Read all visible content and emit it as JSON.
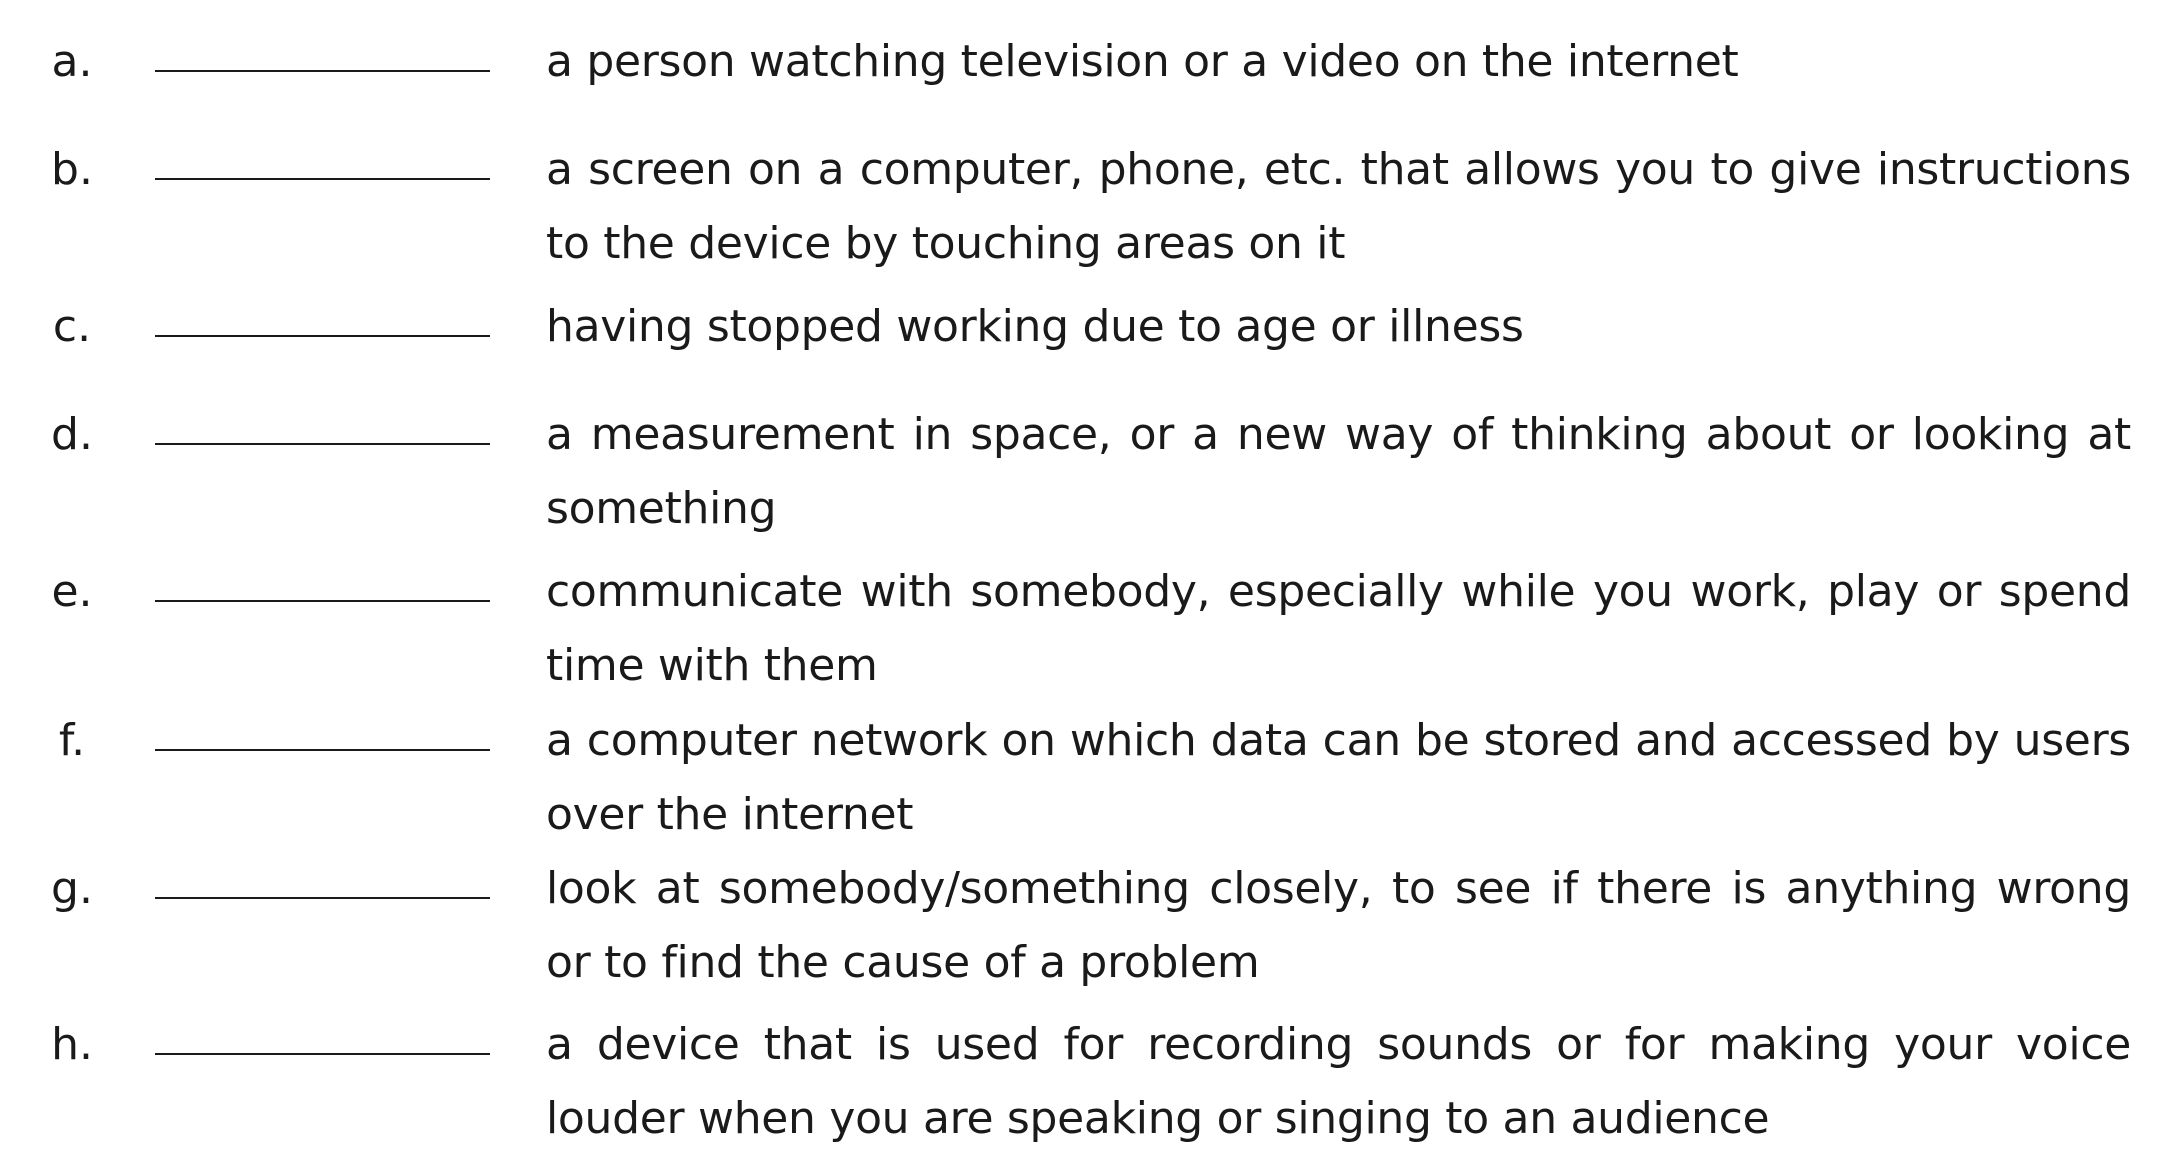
{
  "items": [
    {
      "letter": "a.",
      "definition": "a person watching television or a video on the internet"
    },
    {
      "letter": "b.",
      "definition": "a screen on a computer, phone, etc. that allows you to give instructions to the device by touching areas on it"
    },
    {
      "letter": "c.",
      "definition": "having stopped working due to age or illness"
    },
    {
      "letter": "d.",
      "definition": "a measurement in space, or a new way of thinking about or looking at something"
    },
    {
      "letter": "e.",
      "definition": "communicate with somebody, especially while you work, play or spend time with them"
    },
    {
      "letter": "f.",
      "definition": "a computer network on which data can be stored and accessed by users over the internet"
    },
    {
      "letter": "g.",
      "definition": "look at somebody/something closely, to see if there is anything wrong or to find the cause of a problem"
    },
    {
      "letter": "h.",
      "definition": "a device that is used for recording sounds or for making your voice louder when you are speaking or singing to an audience"
    }
  ]
}
